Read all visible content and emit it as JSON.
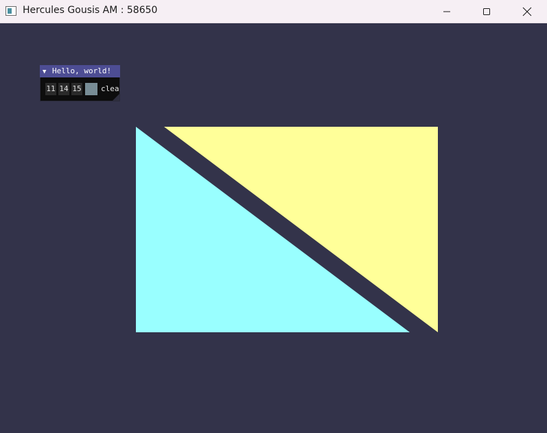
{
  "window": {
    "title": "Hercules Gousis AM : 58650",
    "app_icon": "app-window-icon",
    "controls": [
      "minimize-icon",
      "maximize-icon",
      "close-icon"
    ]
  },
  "scene": {
    "background_color": "#33334a",
    "triangles": [
      {
        "name": "cyan-triangle",
        "color": "#99ffff"
      },
      {
        "name": "yellow-triangle",
        "color": "#ffff99"
      }
    ]
  },
  "imgui": {
    "title_arrow": "▼",
    "title": "Hello, world!",
    "color_r": "11",
    "color_g": "14",
    "color_b": "15",
    "swatch_color": "#788d96",
    "color_label": "clear color"
  }
}
